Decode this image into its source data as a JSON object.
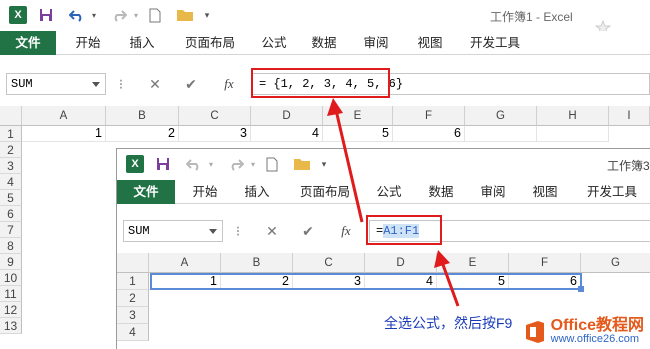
{
  "window1": {
    "title": "工作簿1 - Excel",
    "ribbon_tabs": [
      "文件",
      "开始",
      "插入",
      "页面布局",
      "公式",
      "数据",
      "审阅",
      "视图",
      "开发工具"
    ],
    "name_box": "SUM",
    "cancel_glyph": "✕",
    "enter_glyph": "✔",
    "fx_label": "fx",
    "formula": "= {1, 2, 3, 4, 5, 6}",
    "columns": [
      "A",
      "B",
      "C",
      "D",
      "E",
      "F",
      "G",
      "H",
      "I"
    ],
    "rows": [
      "1",
      "2",
      "3",
      "4",
      "5",
      "6",
      "7",
      "8",
      "9",
      "10",
      "11",
      "12",
      "13"
    ],
    "row1_values": [
      "1",
      "2",
      "3",
      "4",
      "5",
      "6"
    ]
  },
  "window2": {
    "title": "工作簿3",
    "ribbon_tabs": [
      "文件",
      "开始",
      "插入",
      "页面布局",
      "公式",
      "数据",
      "审阅",
      "视图",
      "开发工具"
    ],
    "name_box": "SUM",
    "cancel_glyph": "✕",
    "enter_glyph": "✔",
    "fx_label": "fx",
    "formula_prefix": "=",
    "formula_ref": "A1:F1",
    "columns": [
      "A",
      "B",
      "C",
      "D",
      "E",
      "F",
      "G"
    ],
    "rows": [
      "1",
      "2",
      "3",
      "4"
    ],
    "row1_values": [
      "1",
      "2",
      "3",
      "4",
      "5",
      "6"
    ]
  },
  "annotation": {
    "caption": "全选公式，然后按F9"
  },
  "watermark": {
    "brand": "Office教程网",
    "url": "www.office26.com"
  },
  "colors": {
    "excel_green": "#217346",
    "highlight_red": "#e01b1b",
    "caption_blue": "#1a3bb8",
    "selection_blue": "#cfe3f7"
  }
}
